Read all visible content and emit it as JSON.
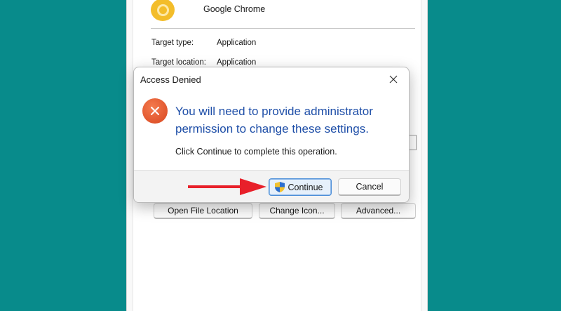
{
  "background_window": {
    "app_name": "Google Chrome",
    "app_icon": "chrome-icon",
    "properties": [
      {
        "label": "Target type:",
        "value": "Application"
      },
      {
        "label": "Target location:",
        "value": "Application"
      }
    ],
    "buttons": {
      "open_file_location": "Open File Location",
      "change_icon": "Change Icon...",
      "advanced": "Advanced..."
    }
  },
  "dialog": {
    "title": "Access Denied",
    "close_icon": "close-icon",
    "error_icon": "error-icon",
    "heading": "You will need to provide administrator permission to change these settings.",
    "message": "Click Continue to complete this operation.",
    "continue_label": "Continue",
    "continue_icon": "uac-shield-icon",
    "cancel_label": "Cancel"
  },
  "annotation": {
    "icon": "red-arrow-icon",
    "color": "#e8202a"
  },
  "colors": {
    "desktop": "#088b8b",
    "heading_blue": "#1f4fa8",
    "accent_border": "#4d8fd8"
  }
}
